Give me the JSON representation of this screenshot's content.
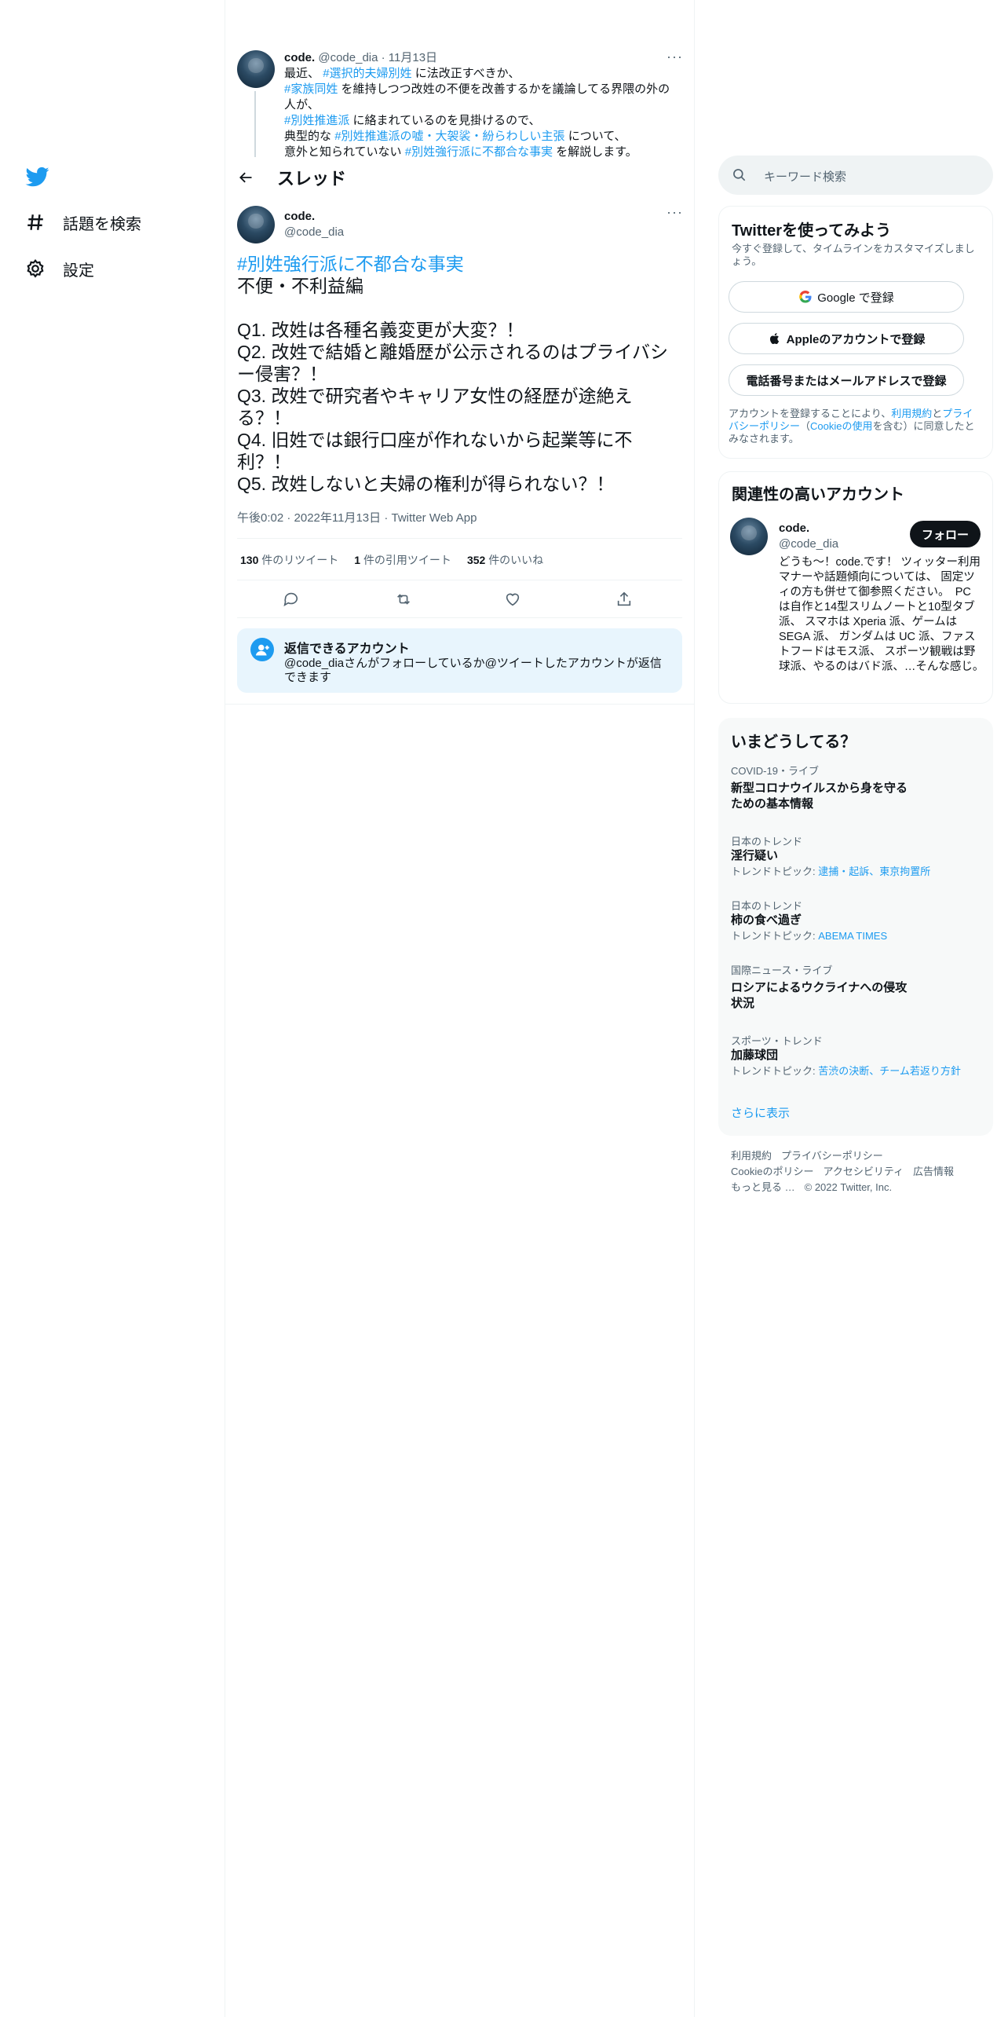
{
  "nav": {
    "explore_label": "話題を検索",
    "settings_label": "設定"
  },
  "previous_tweet": {
    "display_name": "code.",
    "handle_time": "@code_dia · 11月13日",
    "line1_pre": "最近、",
    "line1_tag": "#選択的夫婦別姓",
    "line1_post": "に法改正すべきか、",
    "line2_tag": "#家族同姓",
    "line2_post": "を維持しつつ改姓の不便を改善するかを議論してる界隈の外の人が、",
    "line3_tag": "#別姓推進派",
    "line3_post": "に絡まれているのを見掛けるので、",
    "line4_pre": "典型的な",
    "line4_tag": "#別姓推進派の嘘・大袈裟・紛らわしい主張",
    "line4_post": "について、",
    "line5_pre": "意外と知られていない",
    "line5_tag": "#別姓強行派に不都合な事実",
    "line5_post": "を解説します。"
  },
  "header": {
    "title": "スレッド"
  },
  "tweet": {
    "display_name": "code.",
    "handle": "@code_dia",
    "hashtag": "#別姓強行派に不都合な事実",
    "body": "不便・不利益編\n\nQ1. 改姓は各種名義変更が大変？！\nQ2. 改姓で結婚と離婚歴が公示されるのはプライバシー侵害？！\nQ3. 改姓で研究者やキャリア女性の経歴が途絶える？！\nQ4. 旧姓では銀行口座が作れないから起業等に不利？！\nQ5. 改姓しないと夫婦の権利が得られない？！",
    "meta": "午後0:02 · 2022年11月13日 · Twitter Web App",
    "retweets": "130",
    "retweets_label": "件のリツイート",
    "quotes": "1",
    "quotes_label": "件の引用ツイート",
    "likes": "352",
    "likes_label": "件のいいね"
  },
  "reply_box": {
    "title": "返信できるアカウント",
    "text": "@code_diaさんがフォローしているか@ツイートしたアカウントが返信できます"
  },
  "search": {
    "placeholder": "キーワード検索"
  },
  "signup": {
    "title": "Twitterを使ってみよう",
    "subtitle": "今すぐ登録して、タイムラインをカスタマイズしましょう。",
    "google": "Google で登録",
    "apple": "Appleのアカウントで登録",
    "phone": "電話番号またはメールアドレスで登録",
    "legal_pre": "アカウントを登録することにより、",
    "legal_terms": "利用規約",
    "legal_and": "と",
    "legal_privacy": "プライバシーポリシー",
    "legal_paren_open": "（",
    "legal_cookie": "Cookieの使用",
    "legal_post": "を含む）に同意したとみなされます。"
  },
  "related": {
    "title": "関連性の高いアカウント",
    "display_name": "code.",
    "handle": "@code_dia",
    "follow": "フォロー",
    "bio": "どうも～！code.です！ ツィッター利用マナーや話題傾向については、 固定ツィの方も併せて御参照ください。　PC は自作と14型スリムノートと10型タブ派、 スマホは Xperia 派、ゲームは SEGA 派、 ガンダムは UC 派、ファストフードはモス派、 スポーツ観戦は野球派、やるのはバド派、…そんな感じ。"
  },
  "trends": {
    "title": "いまどうしてる？",
    "items": [
      {
        "cat": "COVID-19・ライブ",
        "name": "新型コロナウイルスから身を守るための基本情報",
        "topic_label": "",
        "topic": ""
      },
      {
        "cat": "日本のトレンド",
        "name": "淫行疑い",
        "topic_label": "トレンドトピック: ",
        "topic": "逮捕・起訴、東京拘置所"
      },
      {
        "cat": "日本のトレンド",
        "name": "柿の食べ過ぎ",
        "topic_label": "トレンドトピック: ",
        "topic": "ABEMA TIMES"
      },
      {
        "cat": "国際ニュース・ライブ",
        "name": "ロシアによるウクライナへの侵攻状況",
        "topic_label": "",
        "topic": ""
      },
      {
        "cat": "スポーツ・トレンド",
        "name": "加藤球団",
        "topic_label": "トレンドトピック: ",
        "topic": "苦渋の決断、チーム若返り方針"
      }
    ],
    "show_more": "さらに表示"
  },
  "footer": {
    "terms": "利用規約",
    "privacy": "プライバシーポリシー",
    "cookie": "Cookieのポリシー",
    "accessibility": "アクセシビリティ",
    "ads": "広告情報",
    "more": "もっと見る …",
    "copyright": "© 2022 Twitter, Inc."
  }
}
